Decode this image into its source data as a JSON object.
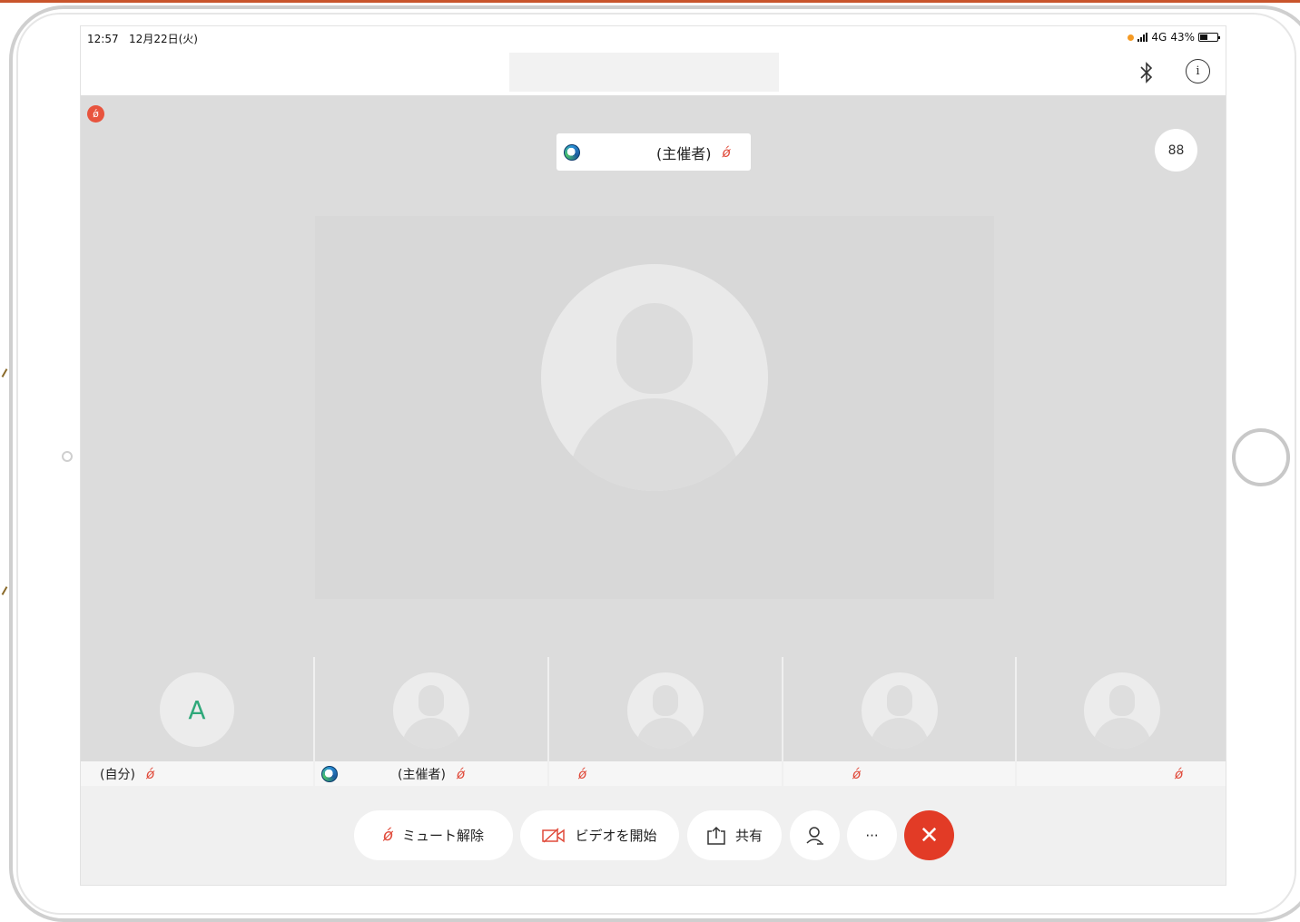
{
  "status": {
    "time": "12:57",
    "date": "12月22日(火)",
    "network": "4G",
    "battery": "43%"
  },
  "stage": {
    "host_label": "(主催者)",
    "mute_glyph": "ǿ"
  },
  "participants": [
    {
      "initial": "A",
      "label": "(自分)"
    },
    {
      "label": "(主催者)"
    },
    {
      "label": ""
    },
    {
      "label": ""
    },
    {
      "label": ""
    }
  ],
  "toolbar": {
    "unmute_label": "ミュート解除",
    "start_video_label": "ビデオを開始",
    "share_label": "共有",
    "more_label": "···",
    "end_label": "✕"
  },
  "icons": {
    "info": "i",
    "grid": "88"
  },
  "colors": {
    "mute_red": "#e04a3a",
    "end_call": "#e23b26",
    "avatar_initial": "#2fa87a"
  }
}
